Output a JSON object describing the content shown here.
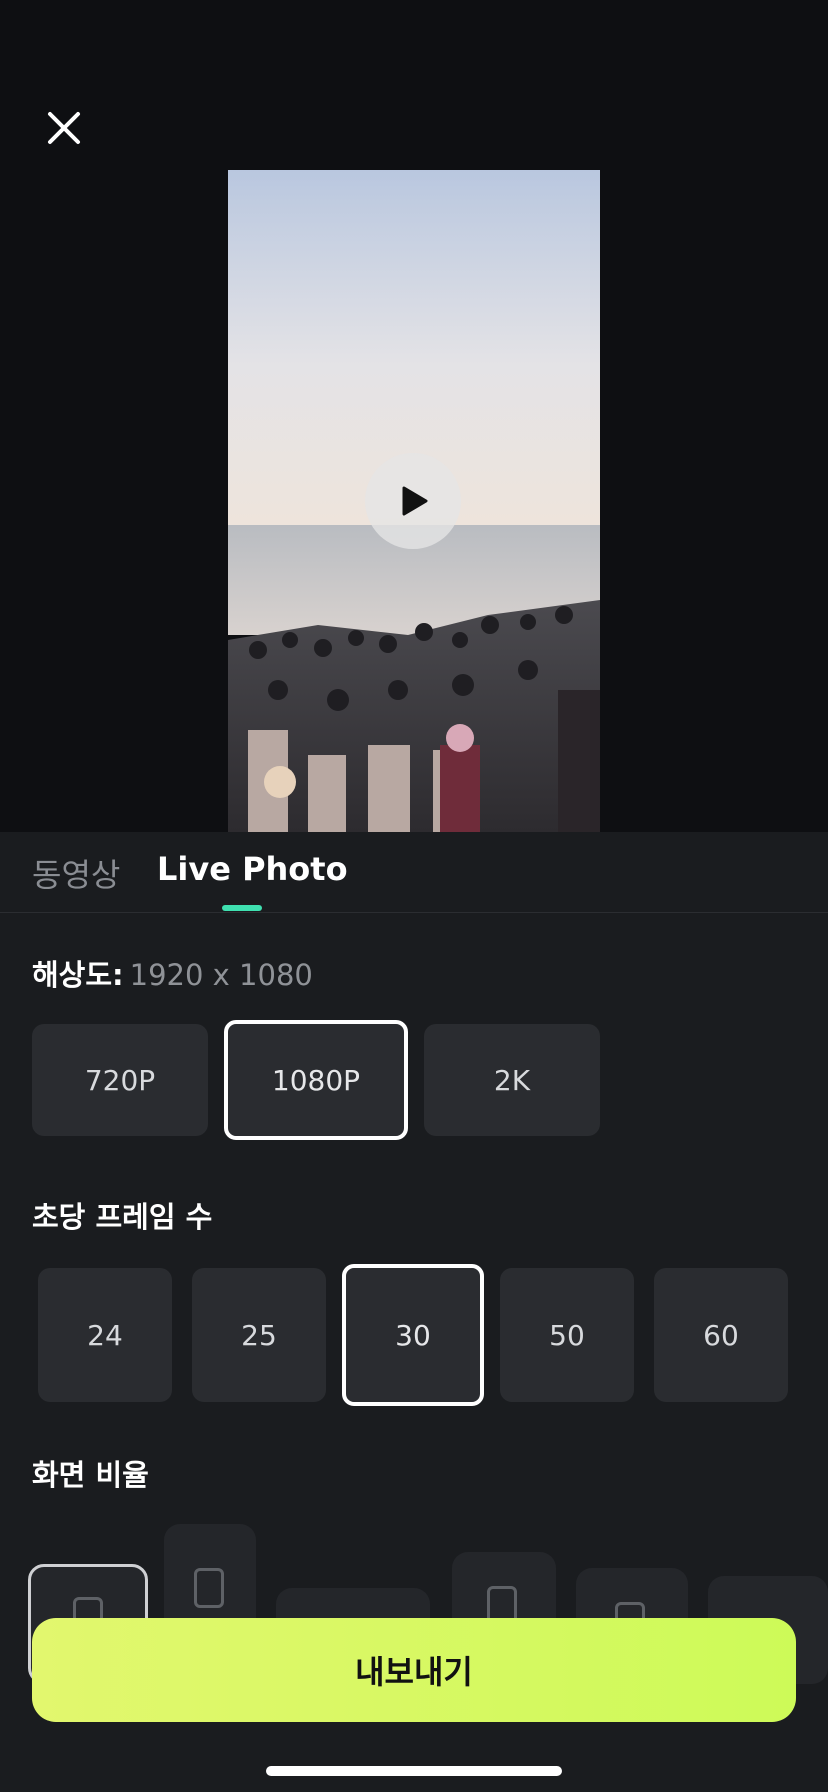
{
  "header": {
    "close_icon": "close-icon"
  },
  "preview": {
    "play_icon": "play-icon"
  },
  "tabs": [
    {
      "label": "동영상"
    },
    {
      "label": "Live Photo"
    }
  ],
  "resolution": {
    "label": "해상도:",
    "value": "1920 x 1080",
    "options": [
      "720P",
      "1080P",
      "2K"
    ],
    "selected": "1080P"
  },
  "fps": {
    "label": "초당 프레임 수",
    "options": [
      "24",
      "25",
      "30",
      "50",
      "60"
    ],
    "selected": "30"
  },
  "aspect_ratio": {
    "label": "화면 비율",
    "option_icons": [
      "ratio-icon",
      "tiktok-icon",
      "ratio-icon",
      "instagram-icon",
      "youtube-icon",
      "ratio-icon"
    ]
  },
  "export": {
    "label": "내보내기"
  },
  "colors": {
    "accent_tab": "#3fe0b0",
    "export_button": "#d6f964",
    "background": "#0e0f12",
    "panel": "#1a1c1f"
  }
}
